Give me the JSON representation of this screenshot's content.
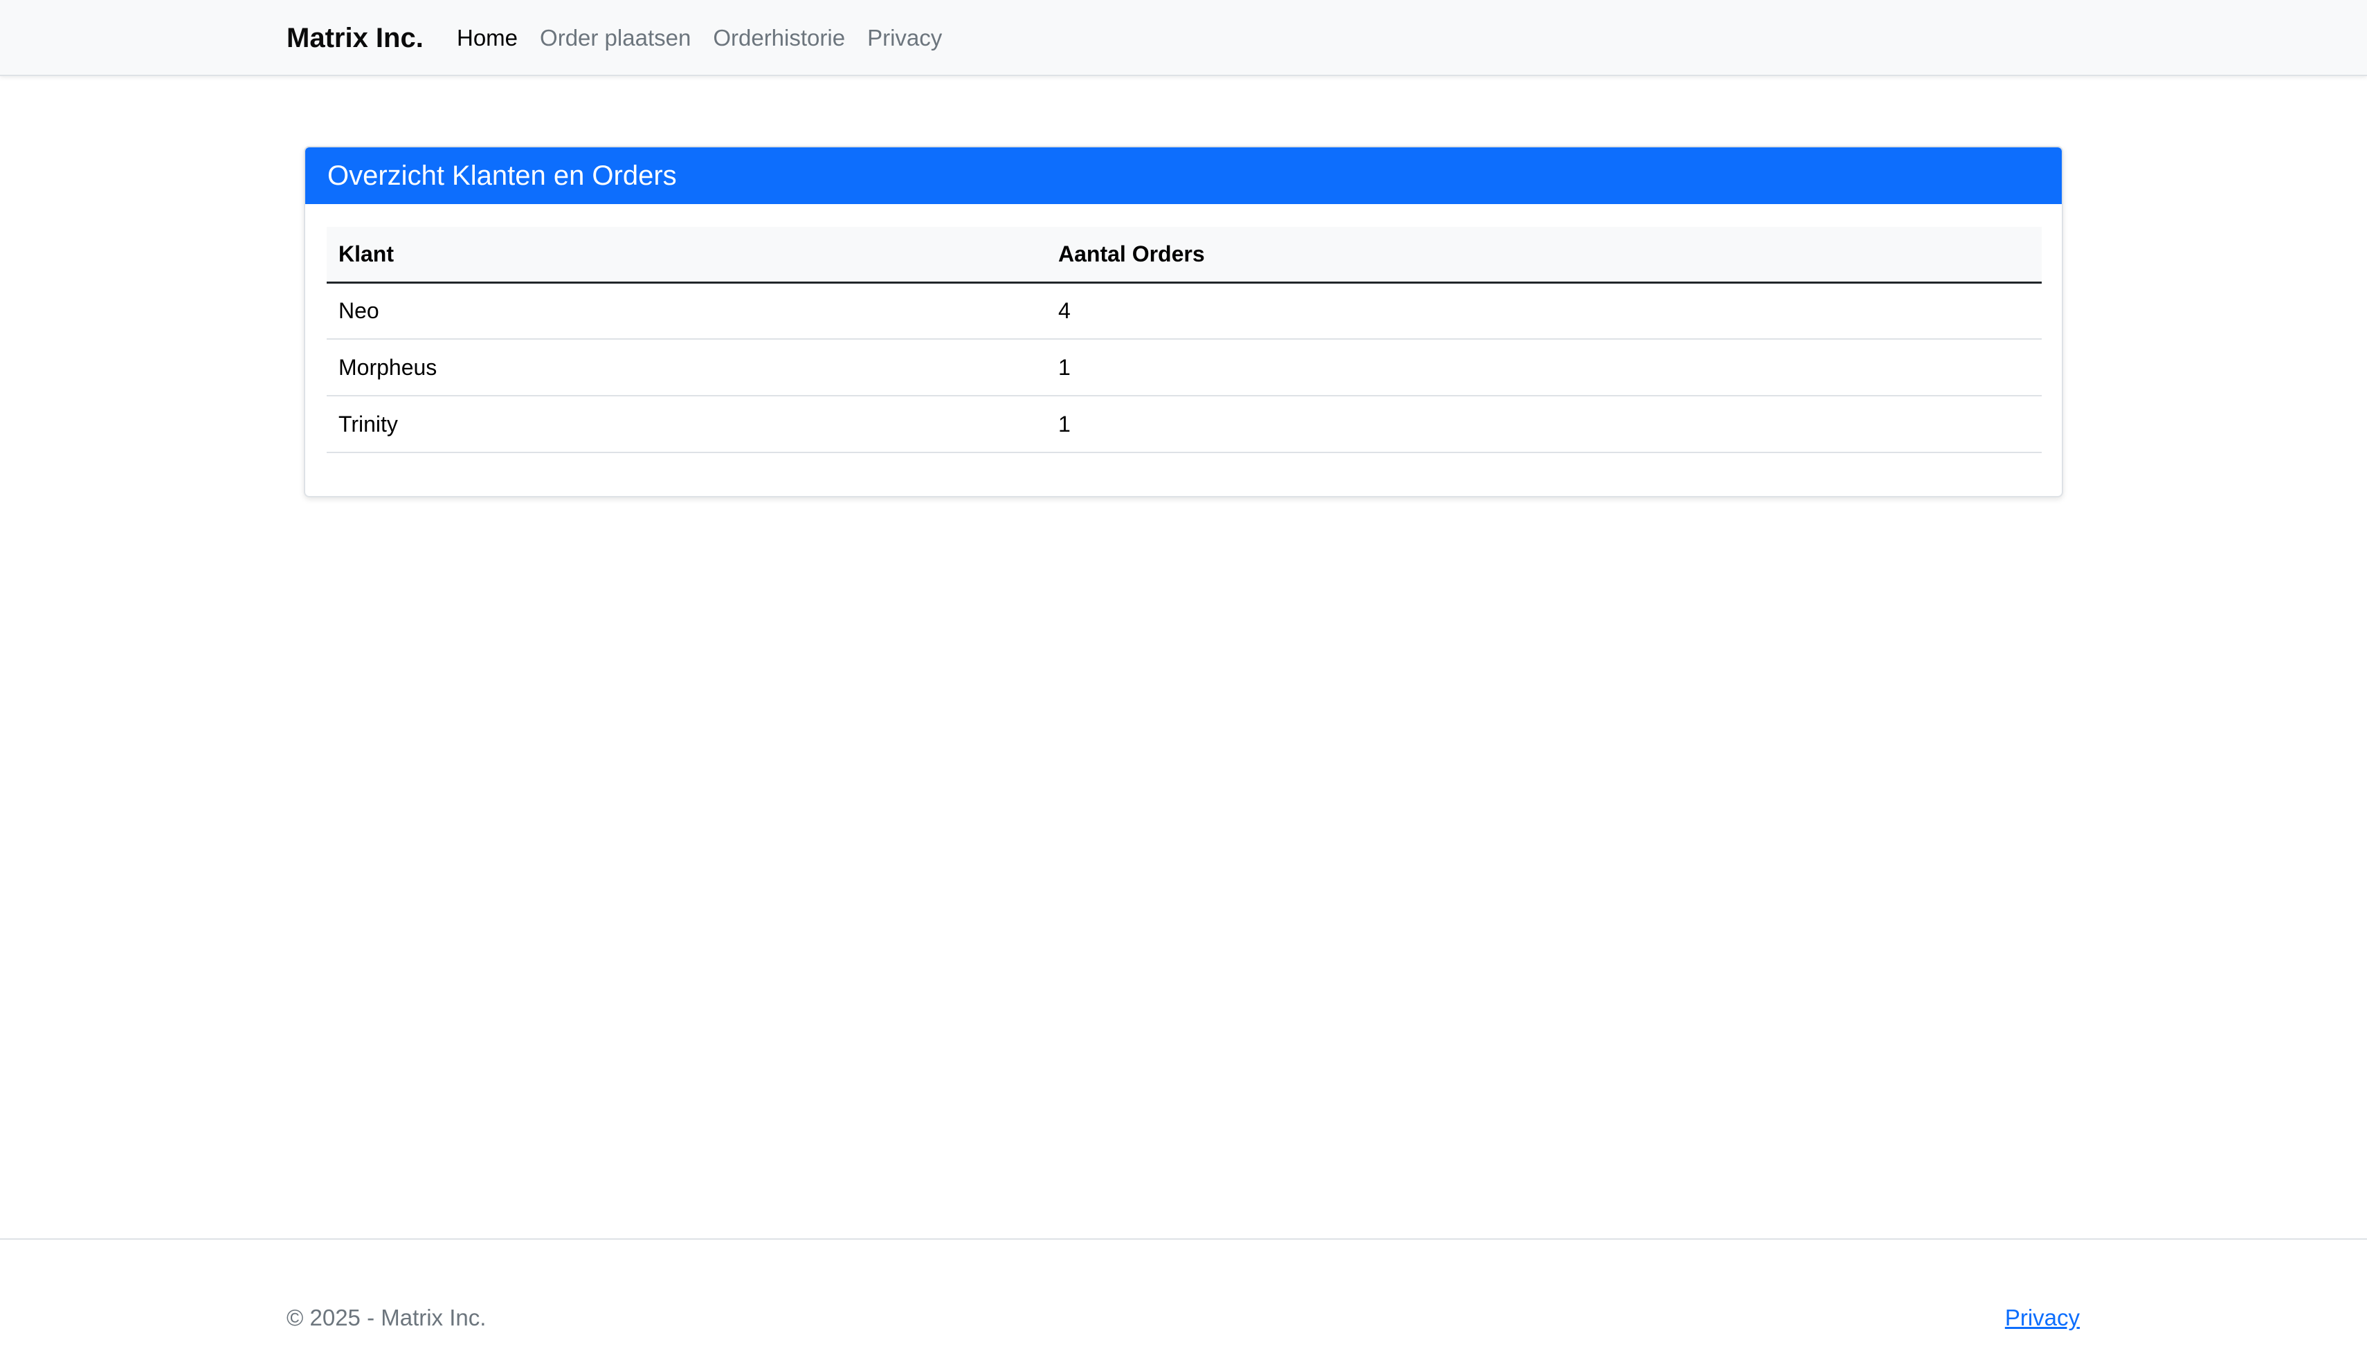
{
  "navbar": {
    "brand": "Matrix Inc.",
    "links": [
      {
        "label": "Home",
        "active": true
      },
      {
        "label": "Order plaatsen",
        "active": false
      },
      {
        "label": "Orderhistorie",
        "active": false
      },
      {
        "label": "Privacy",
        "active": false
      }
    ]
  },
  "card": {
    "title": "Overzicht Klanten en Orders",
    "table": {
      "headers": [
        "Klant",
        "Aantal Orders"
      ],
      "rows": [
        [
          "Neo",
          "4"
        ],
        [
          "Morpheus",
          "1"
        ],
        [
          "Trinity",
          "1"
        ]
      ]
    }
  },
  "footer": {
    "copyright": "© 2025 - Matrix Inc.",
    "privacy_link": "Privacy"
  },
  "colors": {
    "primary": "#0d6efd",
    "navbar_bg": "#f8f9fa",
    "muted_text": "#6c757d"
  }
}
